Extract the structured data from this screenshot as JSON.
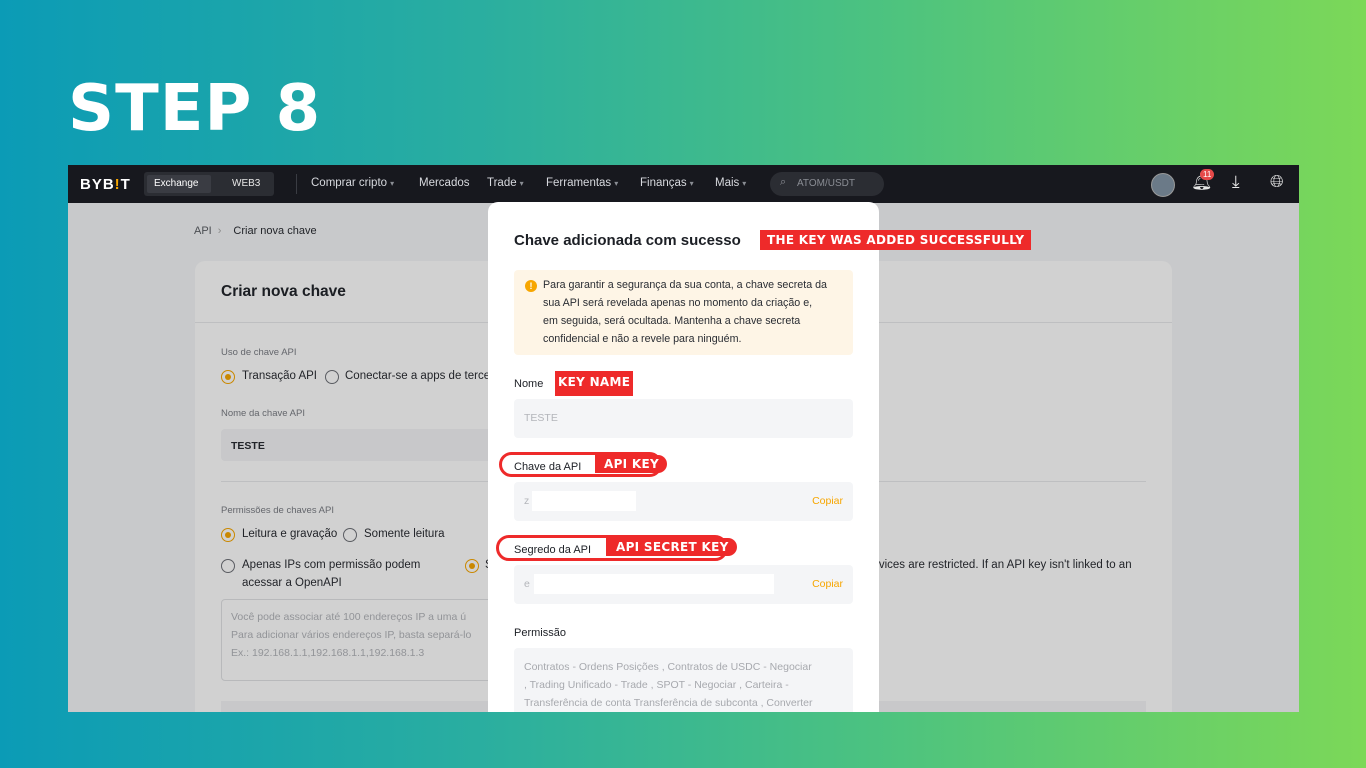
{
  "step_title": "STEP 8",
  "nav": {
    "logo_pre": "BYB",
    "logo_mark": "!",
    "logo_post": "T",
    "seg_exchange": "Exchange",
    "seg_web3": "WEB3",
    "items": [
      "Comprar cripto",
      "Mercados",
      "Trade",
      "Ferramentas",
      "Finanças",
      "Mais"
    ],
    "search_placeholder": "ATOM/USDT",
    "notification_count": "11"
  },
  "page": {
    "breadcrumb_root": "API",
    "breadcrumb_current": "Criar nova chave",
    "card_title": "Criar nova chave",
    "usage_label": "Uso de chave API",
    "usage_opt1": "Transação API",
    "usage_opt2": "Conectar-se a apps de terce",
    "name_label": "Nome da chave API",
    "name_value": "TESTE",
    "perm_label": "Permissões de chaves API",
    "perm_opt1": "Leitura e gravação",
    "perm_opt2": "Somente leitura",
    "ip_opt1_line1": "Apenas IPs com permissão podem",
    "ip_opt1_line2": "acessar a OpenAPI",
    "ip_opt2_char": "S",
    "ip_opt2_partial": "rvices are restricted. If an API key isn't linked to an",
    "ip_hint1": "Você pode associar até 100 endereços IP a uma ú",
    "ip_hint2": "Para adicionar vários endereços IP, basta separá-lo",
    "ip_hint3": "Ex.: 192.168.1.1,192.168.1.1,192.168.1.3"
  },
  "modal": {
    "title": "Chave adicionada com sucesso",
    "notice_lines": [
      "Para garantir a segurança da sua conta, a chave secreta da",
      "sua API será revelada apenas no momento da criação e,",
      "em seguida, será ocultada. Mantenha a chave secreta",
      "confidencial e não a revele para ninguém."
    ],
    "name_label": "Nome",
    "name_value": "TESTE",
    "api_key_label": "Chave da API",
    "api_key_value": "z",
    "secret_label": "Segredo da API",
    "secret_value": "e",
    "copy_label": "Copiar",
    "permission_label": "Permissão",
    "permission_lines": [
      "Contratos - Ordens  Posições   , Contratos de USDC - Negociar",
      ", Trading Unificado - Trade  , SPOT - Negociar  , Carteira -",
      "Transferência de conta Transferência de subconta  , Converter"
    ]
  },
  "annotations": {
    "added": "THE KEY WAS ADDED SUCCESSFULLY",
    "key_name": "KEY NAME",
    "api_key": "API KEY",
    "api_secret": "API SECRET KEY"
  },
  "colors": {
    "accent": "#f7a600",
    "annotation": "#ee2a2a",
    "nav_bg": "#17181e"
  }
}
